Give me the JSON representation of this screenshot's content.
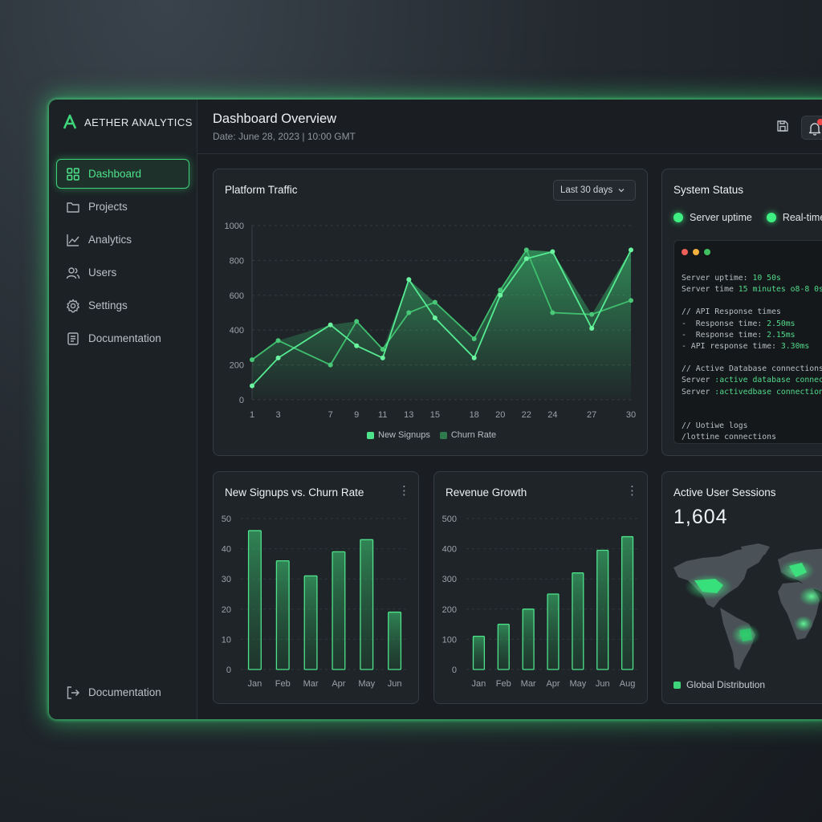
{
  "app": {
    "brand": "AETHER ANALYTICS",
    "accent_color": "#3ed47a"
  },
  "sidebar": {
    "items": [
      {
        "label": "Dashboard",
        "icon": "grid-icon",
        "active": true
      },
      {
        "label": "Projects",
        "icon": "folder-icon"
      },
      {
        "label": "Analytics",
        "icon": "line-chart-icon"
      },
      {
        "label": "Users",
        "icon": "users-icon"
      },
      {
        "label": "Settings",
        "icon": "gear-icon"
      },
      {
        "label": "Documentation",
        "icon": "document-icon"
      }
    ],
    "bottom_item": {
      "label": "Documentation",
      "icon": "logout-icon"
    }
  },
  "header": {
    "title": "Dashboard Overview",
    "date": "Date: June 28, 2023 | 10:00 GMT",
    "icons": [
      "save-icon",
      "bell-icon"
    ],
    "notification_color": "#f04848"
  },
  "platform_traffic": {
    "title": "Platform Traffic",
    "range_selected": "Last 30 days",
    "chart_data": {
      "type": "line",
      "x": [
        1,
        3,
        7,
        9,
        11,
        13,
        15,
        18,
        20,
        22,
        24,
        27,
        30
      ],
      "ylim": [
        0,
        1000
      ],
      "yticks": [
        0,
        200,
        400,
        600,
        800,
        1000
      ],
      "series": [
        {
          "name": "New Signups",
          "values": [
            80,
            240,
            430,
            310,
            240,
            690,
            470,
            240,
            600,
            810,
            850,
            410,
            860
          ],
          "color": "#4ee38a"
        },
        {
          "name": "Churn Rate",
          "values": [
            230,
            340,
            200,
            450,
            290,
            500,
            560,
            350,
            630,
            860,
            500,
            490,
            570
          ],
          "color": "#2f7a4c"
        }
      ],
      "grid": true,
      "legend": "bottom-center"
    }
  },
  "system_status": {
    "title": "System Status",
    "indicators": [
      "Server uptime",
      "Real-time"
    ],
    "terminal": {
      "window_dots": [
        "#f0605a",
        "#f2b040",
        "#40c060"
      ],
      "lines": [
        {
          "text": "Server uptime: ",
          "value": "10 50s"
        },
        {
          "text": "Server time ",
          "value": "15 minutes o8-8 0s"
        },
        {
          "text": "",
          "value": ""
        },
        {
          "text": "// API Response times",
          "value": ""
        },
        {
          "text": "-  Response time: ",
          "value": "2.50ms"
        },
        {
          "text": "-  Response time: ",
          "value": "2.15ms"
        },
        {
          "text": "- API response time: ",
          "value": "3.30ms"
        },
        {
          "text": "",
          "value": ""
        },
        {
          "text": "// Active Database connections",
          "value": ""
        },
        {
          "text": "Server ",
          "value": ":active database connect"
        },
        {
          "text": "Server ",
          "value": ":activedbase connection"
        },
        {
          "text": "",
          "value": ""
        },
        {
          "text": "",
          "value": ""
        },
        {
          "text": "// Uotiwe logs",
          "value": ""
        },
        {
          "text": "/lottine connections",
          "value": ""
        }
      ]
    }
  },
  "signups_churn": {
    "title": "New Signups vs. Churn Rate",
    "chart_data": {
      "type": "bar",
      "categories": [
        "Jan",
        "Feb",
        "Mar",
        "Apr",
        "May",
        "Jun"
      ],
      "values": [
        46,
        36,
        31,
        39,
        43,
        19
      ],
      "ylim": [
        0,
        50
      ],
      "yticks": [
        0,
        10,
        20,
        30,
        40,
        50
      ],
      "grid": true
    }
  },
  "revenue_growth": {
    "title": "Revenue Growth",
    "chart_data": {
      "type": "bar",
      "categories": [
        "Jan",
        "Feb",
        "Mar",
        "Apr",
        "May",
        "Jun",
        "Aug"
      ],
      "values": [
        110,
        150,
        200,
        250,
        320,
        395,
        440
      ],
      "ylim": [
        0,
        500
      ],
      "yticks": [
        0,
        100,
        200,
        300,
        400,
        500
      ],
      "grid": true
    }
  },
  "active_sessions": {
    "title": "Active User Sessions",
    "count": "1,604",
    "map_legend": "Global Distribution"
  }
}
